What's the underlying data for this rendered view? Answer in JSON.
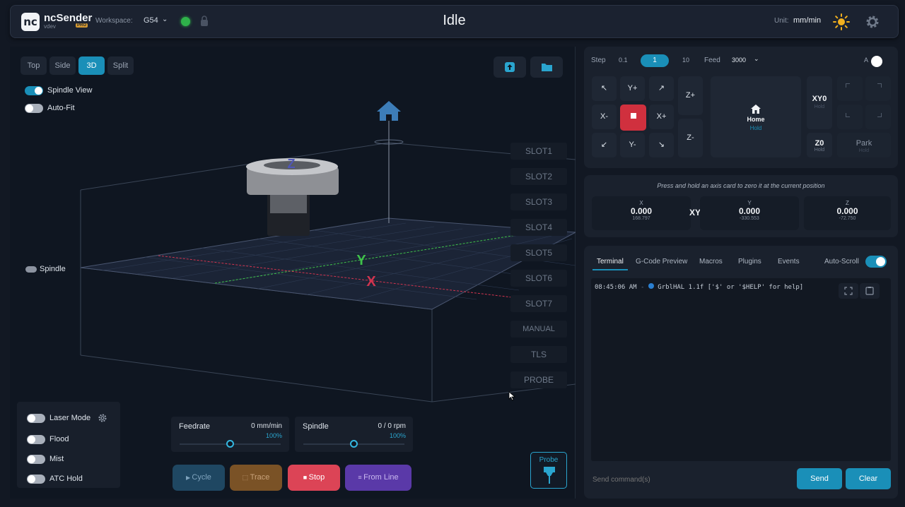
{
  "header": {
    "brand": "ncSender",
    "brand_sub": "vdev",
    "pro_badge": "PRO",
    "workspace_label": "Workspace:",
    "workspace_value": "G54",
    "status": "Idle",
    "unit_label": "Unit:",
    "unit_value": "mm/min",
    "connection_color": "#2fb24a"
  },
  "viewport": {
    "tabs": [
      "Top",
      "Side",
      "3D",
      "Split"
    ],
    "active_tab": "3D",
    "toggles": {
      "spindle_view": "Spindle View",
      "auto_fit": "Auto-Fit",
      "spindle": "Spindle"
    },
    "slots": [
      "SLOT1",
      "SLOT2",
      "SLOT3",
      "SLOT4",
      "SLOT5",
      "SLOT6",
      "SLOT7",
      "MANUAL",
      "TLS",
      "PROBE"
    ],
    "axis_labels": {
      "x": "X",
      "y": "Y",
      "z": "Z"
    },
    "controls": {
      "laser_mode": "Laser Mode",
      "flood": "Flood",
      "mist": "Mist",
      "atc_hold": "ATC Hold"
    },
    "feedrate": {
      "label": "Feedrate",
      "value": "0 mm/min",
      "percent": "100%",
      "level": 0.5
    },
    "spindle_meter": {
      "label": "Spindle",
      "value": "0 / 0 rpm",
      "percent": "100%",
      "level": 0.5
    },
    "actions": {
      "cycle": "Cycle",
      "trace": "Trace",
      "stop": "Stop",
      "from_line": "From Line"
    },
    "probe_label": "Probe"
  },
  "jog": {
    "step_label": "Step",
    "steps": [
      "0.1",
      "1",
      "10"
    ],
    "active_step": "1",
    "feed_label": "Feed",
    "feed_value": "3000",
    "a_label": "A",
    "buttons": {
      "y_plus": "Y+",
      "y_minus": "Y-",
      "x_plus": "X+",
      "x_minus": "X-",
      "z_plus": "Z+",
      "z_minus": "Z-",
      "home": "Home",
      "home_sub": "Hold",
      "xy0": "XY0",
      "xy0_sub": "Hold",
      "z0": "Z0",
      "z0_sub": "Hold",
      "park": "Park",
      "park_sub": "Hold"
    }
  },
  "dro": {
    "hint": "Press and hold an axis card to zero it at the current position",
    "x": {
      "label": "X",
      "value": "0.000",
      "machine": "168.797"
    },
    "xy_label": "XY",
    "y": {
      "label": "Y",
      "value": "0.000",
      "machine": "-330.553"
    },
    "z": {
      "label": "Z",
      "value": "0.000",
      "machine": "-72.750"
    }
  },
  "terminal": {
    "tabs": [
      "Terminal",
      "G-Code Preview",
      "Macros",
      "Plugins",
      "Events"
    ],
    "active_tab": "Terminal",
    "auto_scroll": "Auto-Scroll",
    "time": "08:45:06 AM",
    "line": "GrblHAL 1.1f ['$' or '$HELP' for help]",
    "placeholder": "Send command(s)",
    "send": "Send",
    "clear": "Clear"
  }
}
